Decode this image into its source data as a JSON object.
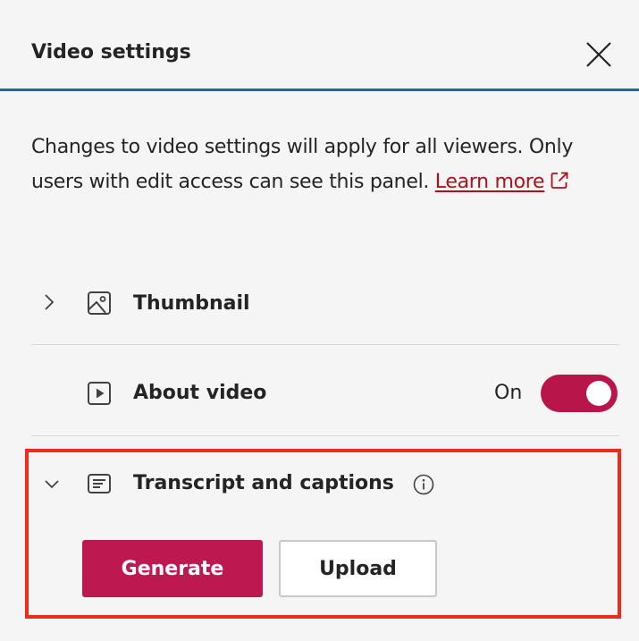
{
  "header": {
    "title": "Video settings",
    "close_icon": "close-icon"
  },
  "intro": {
    "text": "Changes to video settings will apply for all viewers. Only users with edit access can see this panel.",
    "link_text": "Learn more",
    "link_icon": "external-link-icon"
  },
  "sections": {
    "thumbnail": {
      "label": "Thumbnail",
      "icon": "image-icon",
      "chevron": "chevron-right-icon"
    },
    "about_video": {
      "label": "About video",
      "icon": "play-icon",
      "toggle_label": "On",
      "toggle_on": true
    },
    "transcript": {
      "label": "Transcript and captions",
      "icon": "transcript-icon",
      "info_icon": "info-icon",
      "chevron": "chevron-down-icon",
      "generate_label": "Generate",
      "upload_label": "Upload"
    }
  },
  "colors": {
    "accent": "#be1850",
    "header_border": "#1a66c4",
    "highlight": "#f02b1c",
    "link": "#b10e1c"
  }
}
